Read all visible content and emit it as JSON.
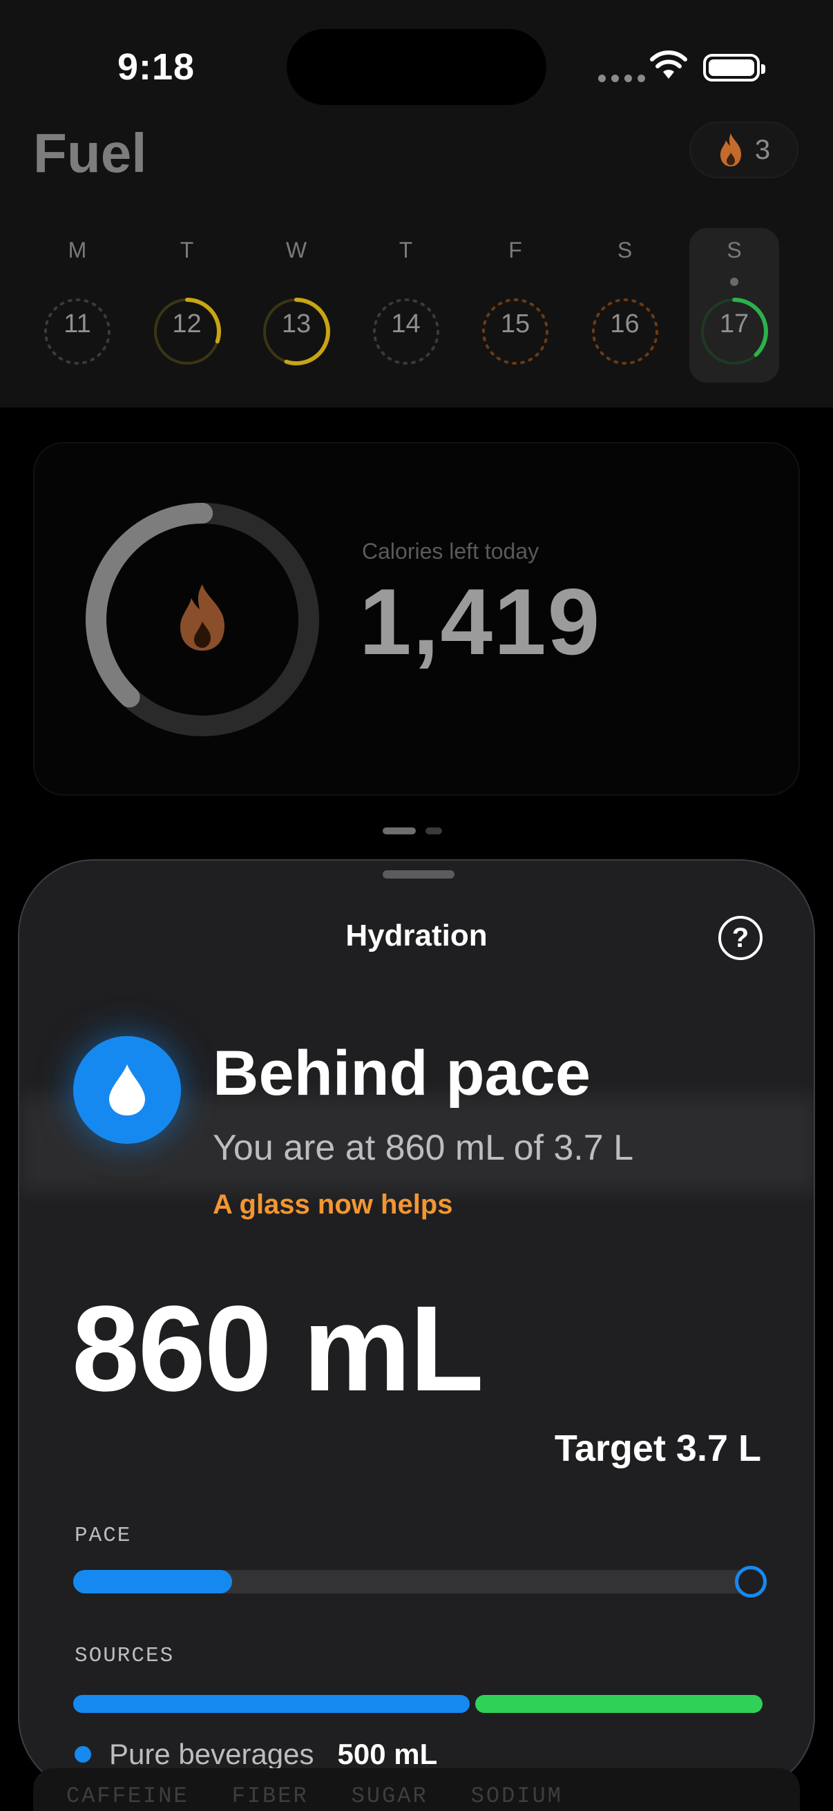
{
  "status_bar": {
    "time": "9:18"
  },
  "header": {
    "app_title": "Fuel",
    "streak_count": "3"
  },
  "week": [
    {
      "letter": "M",
      "date": "11",
      "progress": 0,
      "style": "empty"
    },
    {
      "letter": "T",
      "date": "12",
      "progress": 0.3,
      "style": "partial"
    },
    {
      "letter": "W",
      "date": "13",
      "progress": 0.55,
      "style": "partial"
    },
    {
      "letter": "T",
      "date": "14",
      "progress": 0,
      "style": "empty"
    },
    {
      "letter": "F",
      "date": "15",
      "progress": 0,
      "style": "over"
    },
    {
      "letter": "S",
      "date": "16",
      "progress": 0,
      "style": "over"
    },
    {
      "letter": "S",
      "date": "17",
      "progress": 0.38,
      "style": "today"
    }
  ],
  "calories": {
    "label": "Calories left today",
    "value": "1,419",
    "progress": 0.62
  },
  "sheet": {
    "title": "Hydration",
    "status_title": "Behind pace",
    "status_sub": "You are at 860 mL of 3.7 L",
    "status_hint": "A glass now helps",
    "big_value": "860 mL",
    "target": "Target 3.7 L",
    "pace_label": "PACE",
    "pace_progress": 0.23,
    "sources_label": "SOURCES",
    "sources": [
      {
        "name": "Pure beverages",
        "value": "500 mL",
        "fraction": 0.58
      },
      {
        "fraction": 0.42
      }
    ]
  },
  "bottom_peek": {
    "labels": [
      "CAFFEINE",
      "FIBER",
      "SUGAR",
      "SODIUM"
    ]
  },
  "colors": {
    "accent_blue": "#1689f0",
    "accent_green": "#30d158",
    "accent_orange": "#f39632"
  }
}
